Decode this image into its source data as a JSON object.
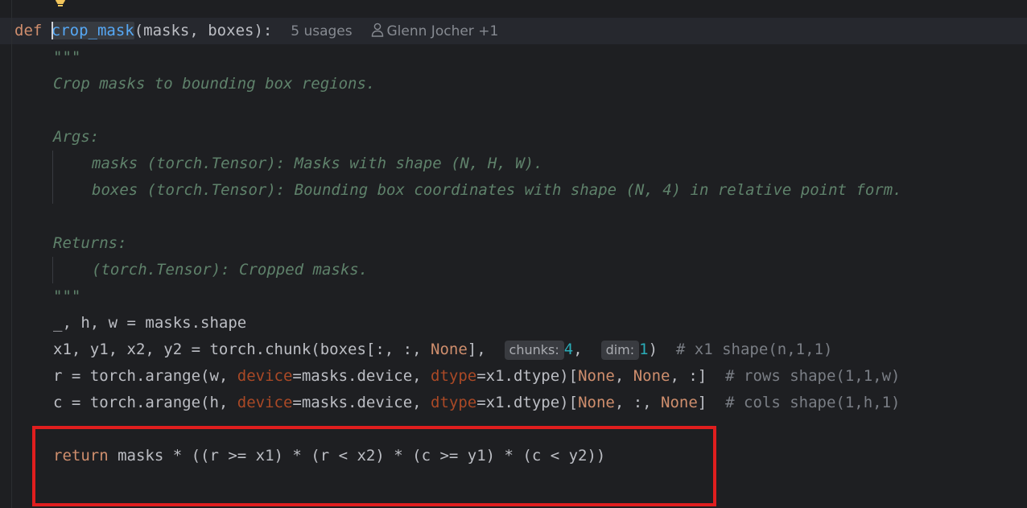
{
  "codelens": {
    "usages": "5 usages",
    "author": "Glenn Jocher +1"
  },
  "signature": {
    "keyword": "def",
    "function_name": "crop_mask",
    "params": "(masks, boxes):"
  },
  "docstring": {
    "open_quotes": "\"\"\"",
    "summary": "Crop masks to bounding box regions.",
    "args_header": "Args:",
    "arg_masks": "masks (torch.Tensor): Masks with shape (N, H, W).",
    "arg_boxes": "boxes (torch.Tensor): Bounding box coordinates with shape (N, 4) in relative point form.",
    "returns_header": "Returns:",
    "returns_desc": "(torch.Tensor): Cropped masks.",
    "close_quotes": "\"\"\""
  },
  "line_shape": "_, h, w = masks.shape",
  "line_chunk": {
    "start": "x1, y1, x2, y2 = torch.chunk(boxes[:, :, ",
    "none": "None",
    "mid": "], ",
    "hint_chunks": "chunks:",
    "chunks_val": "4",
    "comma": ", ",
    "hint_dim": "dim:",
    "dim_val": "1",
    "close": ")",
    "comment": "  # x1 shape(n,1,1)"
  },
  "line_r": {
    "start": "r = torch.arange(w, ",
    "p_device": "device",
    "eq_device": "=masks.device, ",
    "p_dtype": "dtype",
    "eq_dtype": "=x1.dtype)[",
    "none1": "None",
    "sep1": ", ",
    "none2": "None",
    "end": ", :]",
    "comment": "  # rows shape(1,1,w)"
  },
  "line_c": {
    "start": "c = torch.arange(h, ",
    "p_device": "device",
    "eq_device": "=masks.device, ",
    "p_dtype": "dtype",
    "eq_dtype": "=x1.dtype)[",
    "none1": "None",
    "mid": ", :, ",
    "none2": "None",
    "end": "]",
    "comment": "  # cols shape(1,h,1)"
  },
  "line_return": {
    "keyword": "return",
    "expr": " masks * ((r >= x1) * (r < x2) * (c >= y1) * (c < y2))"
  },
  "colors": {
    "background": "#1e1f22",
    "keyword": "#cf8e6d",
    "function": "#56a8f5",
    "docstring": "#5f826b",
    "param": "#aa4926",
    "number": "#2aacb8",
    "comment": "#7a7e85",
    "highlight_box": "#e01e1e"
  }
}
